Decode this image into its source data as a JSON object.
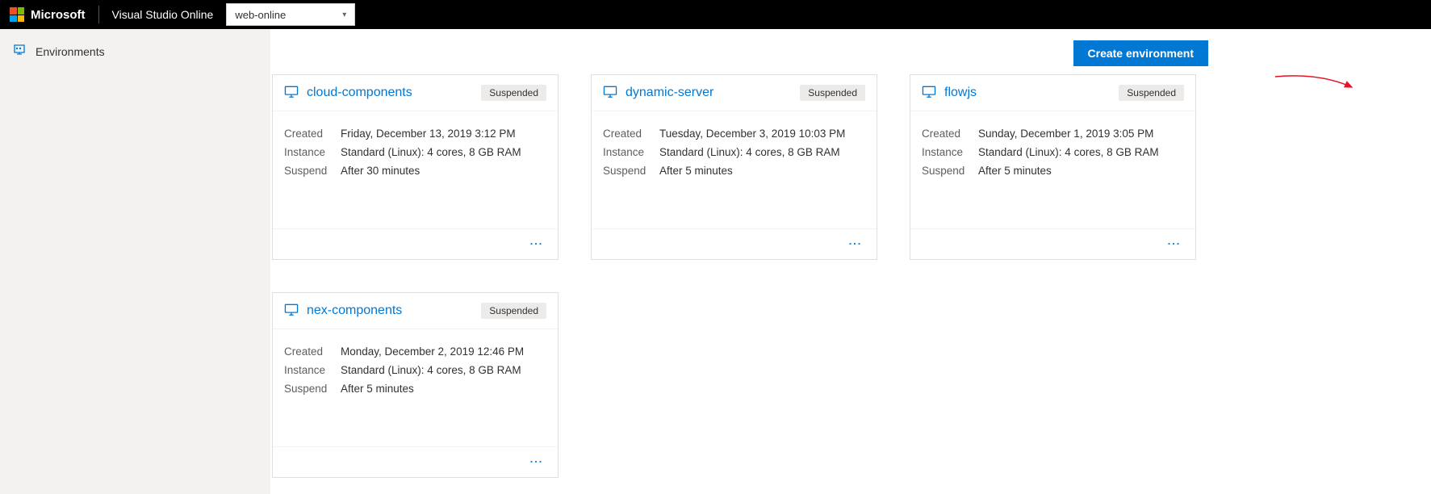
{
  "topbar": {
    "brand": "Microsoft",
    "product": "Visual Studio Online",
    "plan": "web-online"
  },
  "sidebar": {
    "nav_label": "Environments"
  },
  "actions": {
    "create_label": "Create environment"
  },
  "labels": {
    "created": "Created",
    "instance": "Instance",
    "suspend": "Suspend"
  },
  "environments": [
    {
      "name": "cloud-components",
      "status": "Suspended",
      "created": "Friday, December 13, 2019 3:12 PM",
      "instance": "Standard (Linux): 4 cores, 8 GB RAM",
      "suspend": "After 30 minutes"
    },
    {
      "name": "dynamic-server",
      "status": "Suspended",
      "created": "Tuesday, December 3, 2019 10:03 PM",
      "instance": "Standard (Linux): 4 cores, 8 GB RAM",
      "suspend": "After 5 minutes"
    },
    {
      "name": "flowjs",
      "status": "Suspended",
      "created": "Sunday, December 1, 2019 3:05 PM",
      "instance": "Standard (Linux): 4 cores, 8 GB RAM",
      "suspend": "After 5 minutes"
    },
    {
      "name": "nex-components",
      "status": "Suspended",
      "created": "Monday, December 2, 2019 12:46 PM",
      "instance": "Standard (Linux): 4 cores, 8 GB RAM",
      "suspend": "After 5 minutes"
    }
  ]
}
